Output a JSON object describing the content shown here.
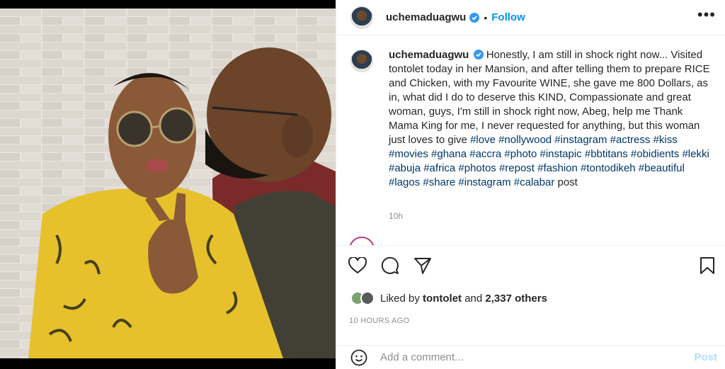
{
  "post": {
    "username": "uchemaduagwu",
    "follow_label": "Follow",
    "dot": "•",
    "more_label": "•••"
  },
  "caption": {
    "username": "uchemaduagwu",
    "text": "Honestly, I am still in shock right now... Visited tontolet today in her Mansion, and after telling them to prepare RICE and Chicken, with my Favourite WINE, she gave me 800 Dollars, as in, what did I do to deserve this KIND, Compassionate and great woman, guys, I'm still in shock right now, Abeg, help me Thank Mama King for me, I never requested for anything, but this woman just loves to give",
    "hashtags": "#love #nollywood #instagram #actress #kiss #movies #ghana #accra #photo #instapic #bbtitans #obidients #lekki #abuja #africa #photos #repost #fashion #tontodikeh #beautiful #lagos #share #instagram #calabar",
    "suffix": "post",
    "time": "10h"
  },
  "likes": {
    "prefix": "Liked by",
    "user": "tontolet",
    "and": "and",
    "others": "2,337 others"
  },
  "timestamp": "10 HOURS AGO",
  "comment": {
    "placeholder": "Add a comment...",
    "post_label": "Post"
  },
  "colors": {
    "accent": "#0095f6",
    "hashtag": "#00376b",
    "muted": "#8e8e8e",
    "post_disabled": "#b2dffc",
    "verified": "#3897f0"
  },
  "icons": [
    "heart-icon",
    "comment-icon",
    "share-icon",
    "bookmark-icon",
    "emoji-icon",
    "verified-icon",
    "more-icon"
  ]
}
